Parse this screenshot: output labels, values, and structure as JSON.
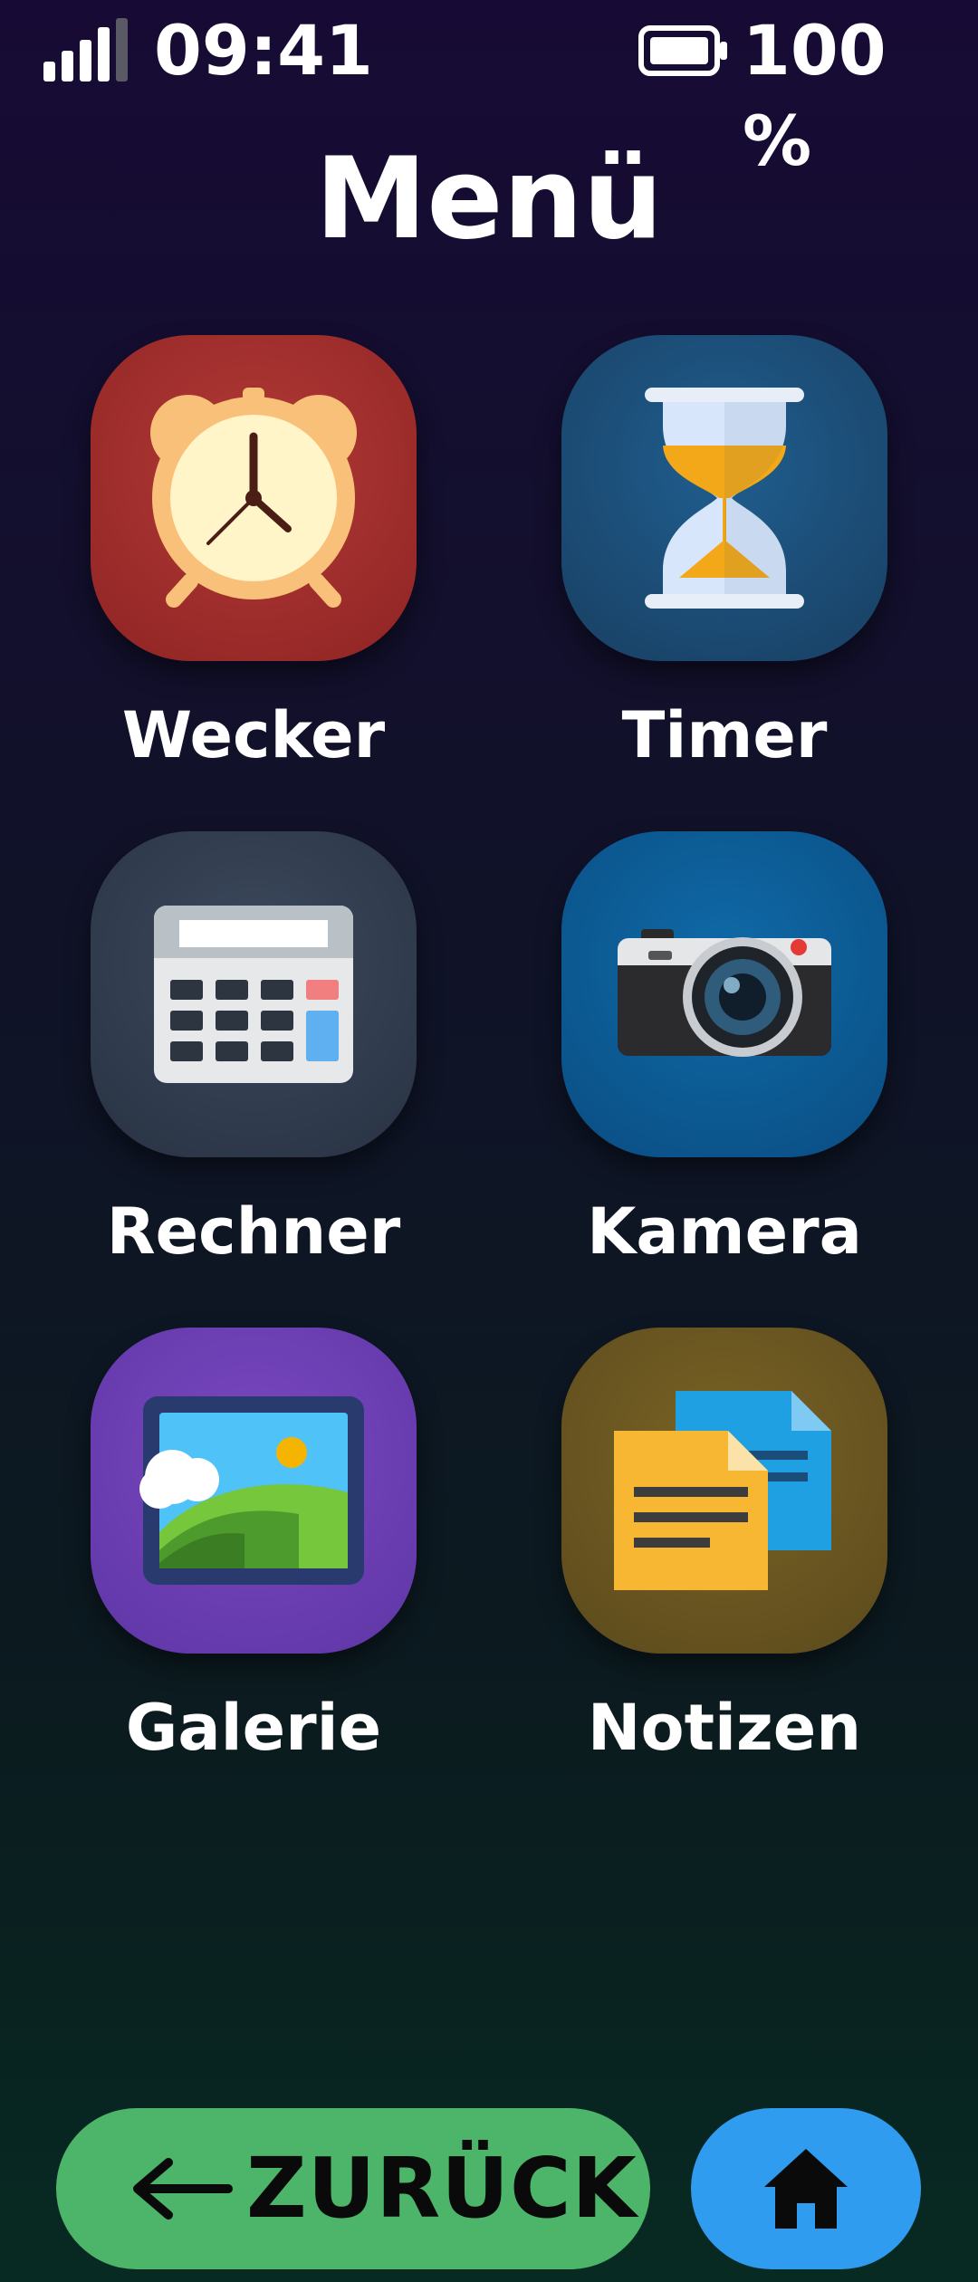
{
  "status_bar": {
    "time": "09:41",
    "battery_percent": "100 %",
    "signal_icon": "signal-bars-icon",
    "battery_icon": "battery-full-icon"
  },
  "title": "Menü",
  "apps": [
    {
      "label": "Wecker",
      "icon": "alarm-clock-icon",
      "color": "#9c2c2b"
    },
    {
      "label": "Timer",
      "icon": "hourglass-icon",
      "color": "#1c4b74"
    },
    {
      "label": "Rechner",
      "icon": "calculator-icon",
      "color": "#313c4e"
    },
    {
      "label": "Kamera",
      "icon": "camera-icon",
      "color": "#0c5a93"
    },
    {
      "label": "Galerie",
      "icon": "picture-icon",
      "color": "#6a3fb5"
    },
    {
      "label": "Notizen",
      "icon": "notes-icon",
      "color": "#6a5520"
    }
  ],
  "bottom_bar": {
    "back_label": "ZURÜCK",
    "back_icon": "arrow-left-icon",
    "home_icon": "home-icon",
    "back_color": "#4db56a",
    "home_color": "#2f9cf0"
  }
}
